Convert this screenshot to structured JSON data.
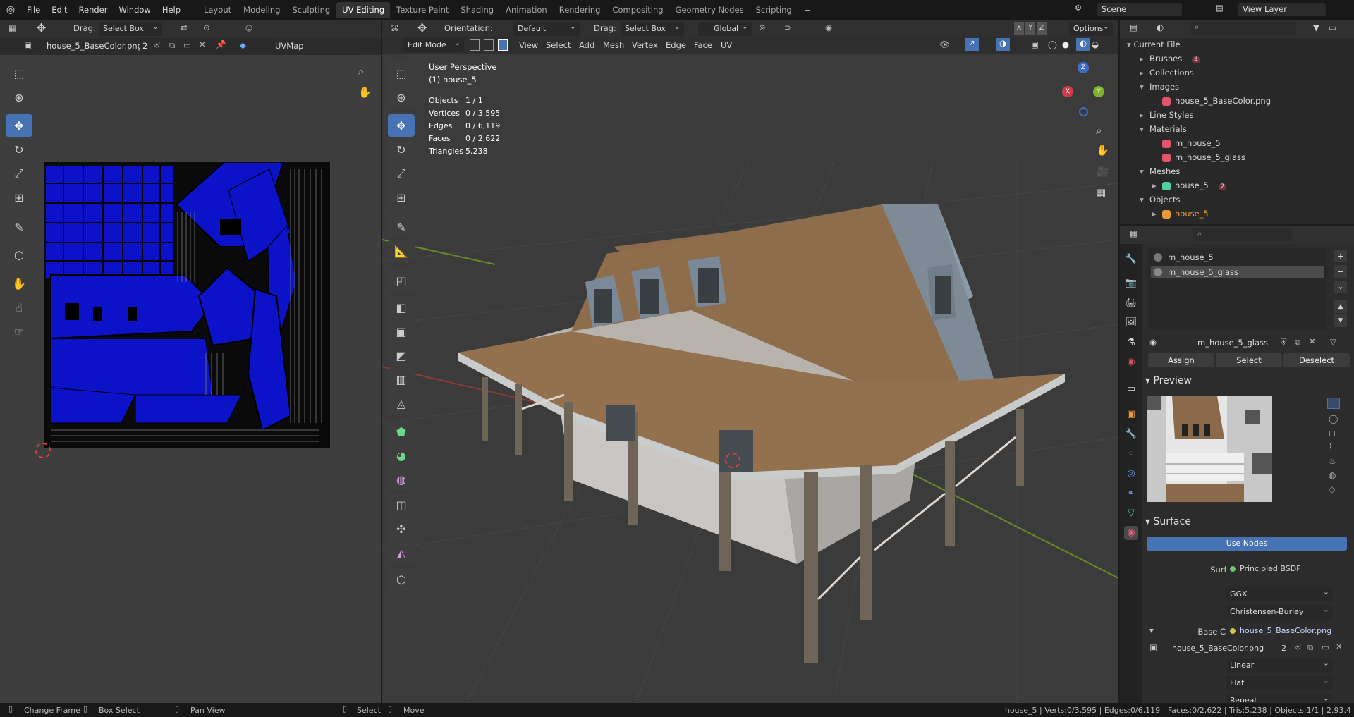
{
  "menus": [
    "File",
    "Edit",
    "Render",
    "Window",
    "Help"
  ],
  "workspaces": [
    "Layout",
    "Modeling",
    "Sculpting",
    "UV Editing",
    "Texture Paint",
    "Shading",
    "Animation",
    "Rendering",
    "Compositing",
    "Geometry Nodes",
    "Scripting"
  ],
  "active_workspace": "UV Editing",
  "scene": {
    "name": "Scene",
    "view_layer": "View Layer"
  },
  "uv_editor": {
    "drag_label": "Drag:",
    "drag_value": "Select Box",
    "image_name": "house_5_BaseColor.png",
    "image_users": "2",
    "uvmap": "UVMap"
  },
  "viewport": {
    "mode": "Edit Mode",
    "orientation_label": "Orientation:",
    "orientation_value": "Default",
    "drag_label": "Drag:",
    "drag_value": "Select Box",
    "transform": "Global",
    "options": "Options",
    "menus": [
      "View",
      "Select",
      "Add",
      "Mesh",
      "Vertex",
      "Edge",
      "Face",
      "UV"
    ],
    "overlay_title": "User Perspective",
    "overlay_object": "(1) house_5",
    "stats": [
      {
        "label": "Objects",
        "value": "1 / 1"
      },
      {
        "label": "Vertices",
        "value": "0 / 3,595"
      },
      {
        "label": "Edges",
        "value": "0 / 6,119"
      },
      {
        "label": "Faces",
        "value": "0 / 2,622"
      },
      {
        "label": "Triangles",
        "value": "5,238"
      }
    ]
  },
  "outliner": {
    "root": "Current File",
    "rows": [
      {
        "label": "Brushes",
        "indent": 1,
        "expand": "▸",
        "badge": "4"
      },
      {
        "label": "Collections",
        "indent": 1,
        "expand": "▸"
      },
      {
        "label": "Images",
        "indent": 1,
        "expand": "▾"
      },
      {
        "label": "house_5_BaseColor.png",
        "indent": 2,
        "expand": ""
      },
      {
        "label": "Line Styles",
        "indent": 1,
        "expand": "▸"
      },
      {
        "label": "Materials",
        "indent": 1,
        "expand": "▾"
      },
      {
        "label": "m_house_5",
        "indent": 2,
        "expand": ""
      },
      {
        "label": "m_house_5_glass",
        "indent": 2,
        "expand": ""
      },
      {
        "label": "Meshes",
        "indent": 1,
        "expand": "▾"
      },
      {
        "label": "house_5",
        "indent": 2,
        "expand": "▸",
        "badge": "2"
      },
      {
        "label": "Objects",
        "indent": 1,
        "expand": "▾"
      },
      {
        "label": "house_5",
        "indent": 2,
        "expand": "▸",
        "highlight": true
      }
    ]
  },
  "properties": {
    "material_slots": [
      "m_house_5",
      "m_house_5_glass"
    ],
    "active_slot": "m_house_5_glass",
    "material_name": "m_house_5_glass",
    "assign": "Assign",
    "select": "Select",
    "deselect": "Deselect",
    "preview_title": "Preview",
    "surface_title": "Surface",
    "use_nodes": "Use Nodes",
    "surface_label": "Surface",
    "surface_value": "Principled BSDF",
    "distribution": "GGX",
    "subsurface": "Christensen-Burley",
    "base_color_label": "Base Color",
    "base_color_value": "house_5_BaseColor.png",
    "image_name": "house_5_BaseColor.png",
    "image_users": "2",
    "interpolation": "Linear",
    "projection": "Flat",
    "extension": "Repeat"
  },
  "statusbar": {
    "items": [
      "Change Frame",
      "Box Select",
      "Pan View",
      "Select",
      "Move"
    ],
    "right": "house_5 | Verts:0/3,595 | Edges:0/6,119 | Faces:0/2,622 | Tris:5,238 | Objects:1/1 | 2.93.4"
  },
  "colors": {
    "accent": "#4772b3",
    "uv_blue": "#0b12c8",
    "header": "#303030",
    "panel": "#282828"
  }
}
